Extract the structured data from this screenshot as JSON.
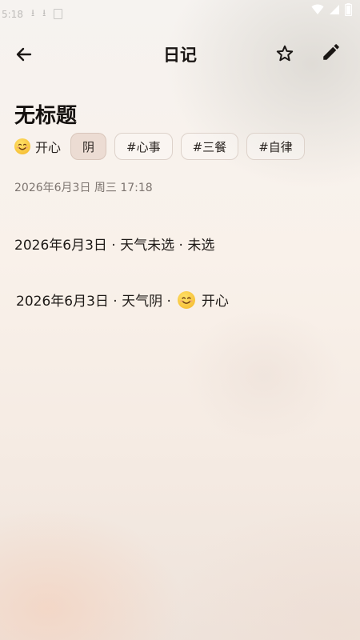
{
  "status_bar": {
    "time": "5:18",
    "icons": [
      "download-icon",
      "download-icon",
      "sd-card-icon",
      "wifi-icon",
      "signal-icon",
      "battery-icon"
    ]
  },
  "app_bar": {
    "title": "日记",
    "back_icon": "arrow-left-icon",
    "favorite_icon": "star-outline-icon",
    "edit_icon": "pencil-icon"
  },
  "entry": {
    "title": "无标题",
    "mood": {
      "icon": "smiling-face-icon",
      "label": "开心"
    },
    "weather": "阴",
    "tags": [
      "#心事",
      "#三餐",
      "#自律"
    ],
    "datetime": "2026年6月3日 周三 17:18"
  },
  "body": {
    "line1": "2026年6月3日 · 天气未选 · 未选",
    "line2_prefix": "2026年6月3日 · 天气阴 ·",
    "line2_mood": "开心"
  }
}
